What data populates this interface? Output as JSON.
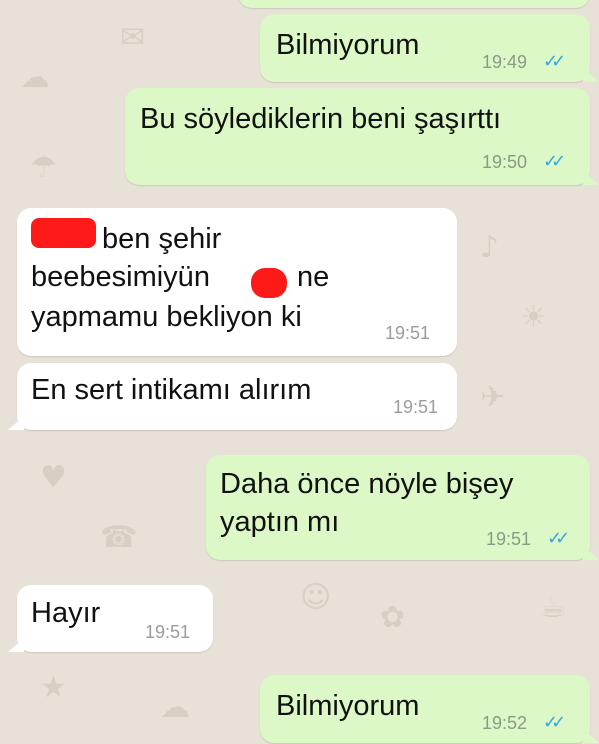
{
  "messages": [
    {
      "text": "Bilmiyorum",
      "time": "19:49",
      "ticks": "✓✓"
    },
    {
      "text": "Bu söylediklerin beni şaşırttı",
      "time": "19:50",
      "ticks": "✓✓"
    },
    {
      "line1": "ben şehir",
      "line2a": "beebesimiyün",
      "line2b": "ne",
      "line3": "yapmamu bekliyon ki",
      "time": "19:51"
    },
    {
      "text": "En sert intikamı alırım",
      "time": "19:51"
    },
    {
      "text": "Daha önce nöyle bişey\nyaptın mı",
      "time": "19:51",
      "ticks": "✓✓"
    },
    {
      "text": "Hayır",
      "time": "19:51"
    },
    {
      "text": "Bilmiyorum",
      "time": "19:52",
      "ticks": "✓✓"
    }
  ],
  "colors": {
    "outgoing": "#dcf8c6",
    "incoming": "#ffffff",
    "read_ticks": "#34a8e0",
    "redaction": "#ff1a1a"
  }
}
